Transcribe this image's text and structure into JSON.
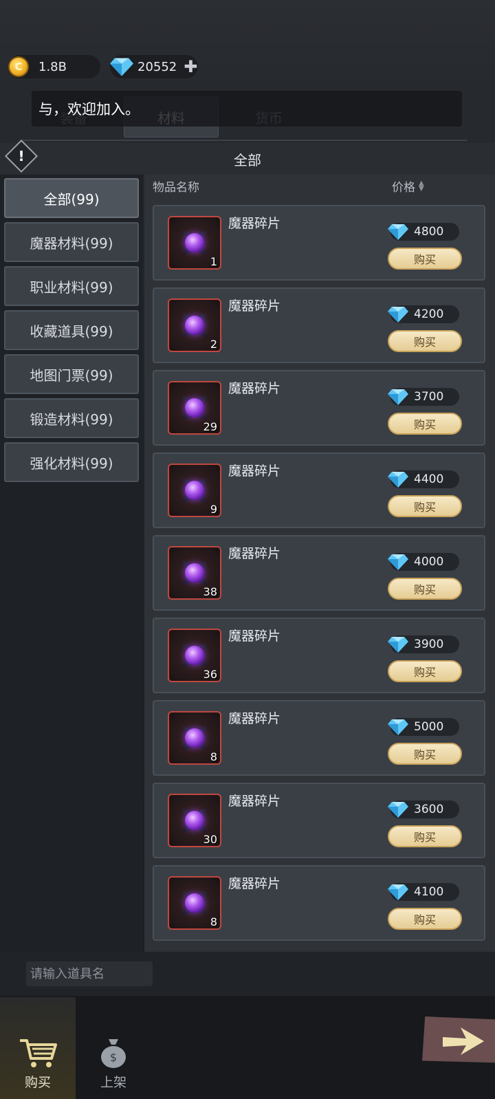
{
  "currency": {
    "gold": "1.8B",
    "gems": "20552"
  },
  "notice": "与，欢迎加入。",
  "tabs": [
    {
      "label": "装备"
    },
    {
      "label": "材料"
    },
    {
      "label": "货币"
    }
  ],
  "category_title": "全部",
  "sidebar": {
    "items": [
      {
        "label": "全部(99)"
      },
      {
        "label": "魔器材料(99)"
      },
      {
        "label": "职业材料(99)"
      },
      {
        "label": "收藏道具(99)"
      },
      {
        "label": "地图门票(99)"
      },
      {
        "label": "锻造材料(99)"
      },
      {
        "label": "强化材料(99)"
      }
    ]
  },
  "list": {
    "name_header": "物品名称",
    "price_header": "价格",
    "buy_label": "购买",
    "items": [
      {
        "name": "魔器碎片",
        "qty": "1",
        "price": "4800"
      },
      {
        "name": "魔器碎片",
        "qty": "2",
        "price": "4200"
      },
      {
        "name": "魔器碎片",
        "qty": "29",
        "price": "3700"
      },
      {
        "name": "魔器碎片",
        "qty": "9",
        "price": "4400"
      },
      {
        "name": "魔器碎片",
        "qty": "38",
        "price": "4000"
      },
      {
        "name": "魔器碎片",
        "qty": "36",
        "price": "3900"
      },
      {
        "name": "魔器碎片",
        "qty": "8",
        "price": "5000"
      },
      {
        "name": "魔器碎片",
        "qty": "30",
        "price": "3600"
      },
      {
        "name": "魔器碎片",
        "qty": "8",
        "price": "4100"
      }
    ]
  },
  "search": {
    "placeholder": "请输入道具名"
  },
  "nav": {
    "buy": "购买",
    "sell": "上架"
  }
}
